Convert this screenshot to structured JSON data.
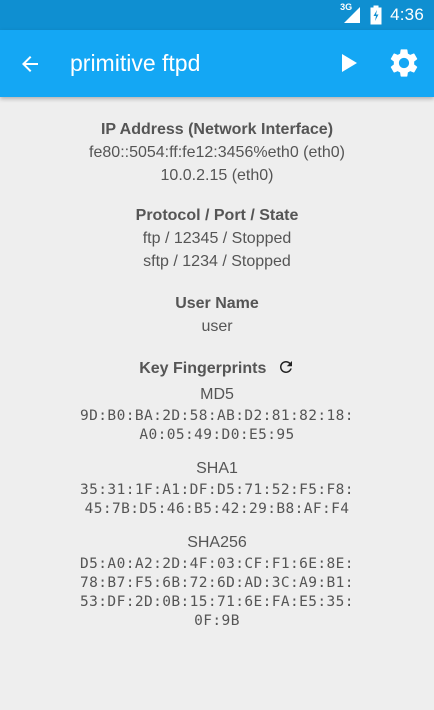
{
  "status_bar": {
    "network": "3G",
    "time": "4:36"
  },
  "app_bar": {
    "title": "primitive ftpd",
    "icons": {
      "back": "arrow-back-icon",
      "start": "play-icon",
      "settings": "gear-icon"
    },
    "color": "#14a7f4",
    "status_color": "#0f8fd1"
  },
  "ip_section": {
    "heading": "IP Address (Network Interface)",
    "lines": [
      "fe80::5054:ff:fe12:3456%eth0 (eth0)",
      "10.0.2.15 (eth0)"
    ]
  },
  "protocol_section": {
    "heading": "Protocol / Port / State",
    "lines": [
      "ftp / 12345 / Stopped",
      "sftp / 1234 / Stopped"
    ]
  },
  "user_section": {
    "heading": "User Name",
    "value": "user"
  },
  "fingerprints_section": {
    "heading": "Key Fingerprints",
    "refresh_icon": "refresh-icon",
    "keys": [
      {
        "algorithm": "MD5",
        "lines": [
          "9D:B0:BA:2D:58:AB:D2:81:82:18:",
          "A0:05:49:D0:E5:95"
        ]
      },
      {
        "algorithm": "SHA1",
        "lines": [
          "35:31:1F:A1:DF:D5:71:52:F5:F8:",
          "45:7B:D5:46:B5:42:29:B8:AF:F4"
        ]
      },
      {
        "algorithm": "SHA256",
        "lines": [
          "D5:A0:A2:2D:4F:03:CF:F1:6E:8E:",
          "78:B7:F5:6B:72:6D:AD:3C:A9:B1:",
          "53:DF:2D:0B:15:71:6E:FA:E5:35:",
          "0F:9B"
        ]
      }
    ]
  }
}
